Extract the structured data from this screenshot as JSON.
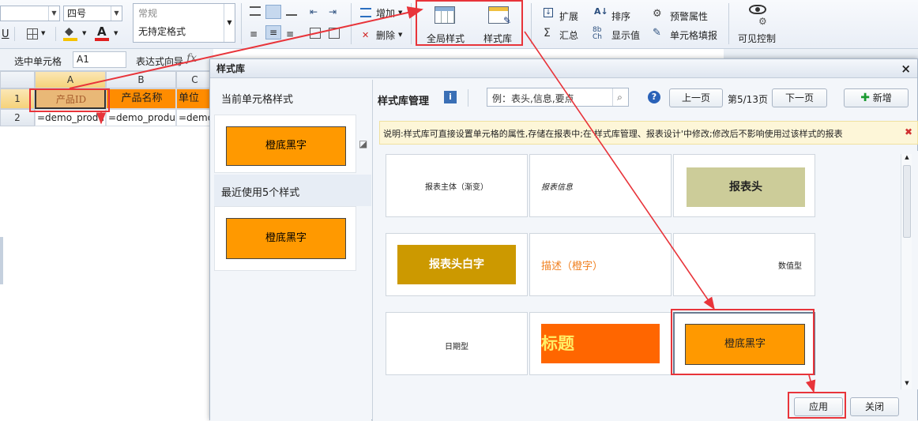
{
  "ribbon": {
    "font_size": "四号",
    "format_label": "常规",
    "format_value": "无持定格式",
    "add_label": "增加",
    "delete_label": "删除",
    "global_style_label": "全局样式",
    "style_lib_label": "样式库",
    "expand_label": "扩展",
    "sort_label": "排序",
    "alert_label": "预警属性",
    "sum_label": "汇总",
    "display_label": "显示值",
    "cell_fill_label": "单元格填报",
    "visible_label": "可见控制",
    "underline": "U",
    "font_color_letter": "A",
    "sigma": "Σ"
  },
  "formula_bar": {
    "selected_label": "选中单元格",
    "cell_ref": "A1",
    "expr_label": "表达式向导",
    "fx": "fx"
  },
  "sheet": {
    "columns": [
      "A",
      "B",
      "C"
    ],
    "rows": [
      "1",
      "2"
    ],
    "row1": [
      "产品ID",
      "产品名称",
      "单位"
    ],
    "row2": [
      "=demo_produ",
      "=demo_produ",
      "=demo_"
    ]
  },
  "dialog": {
    "title": "样式库",
    "close": "×",
    "current_label": "当前单元格样式",
    "current_swatch": "橙底黑字",
    "recent_label": "最近使用5个样式",
    "recent_swatch": "橙底黑字",
    "manage_label": "样式库管理",
    "search_placeholder": "例：表头,信息,要点",
    "prev_label": "上一页",
    "page_info": "第5/13页",
    "next_label": "下一页",
    "add_label": "新增",
    "info_text": "说明:样式库可直接设置单元格的属性,存储在报表中;在'样式库管理、报表设计'中修改;修改后不影响使用过该样式的报表",
    "apply_label": "应用",
    "close_label": "关闭",
    "tiles": [
      "报表主体（渐变）",
      "报表信息",
      "报表头",
      "报表头白字",
      "描述（橙字）",
      "数值型",
      "日期型",
      "标题",
      "橙底黑字"
    ]
  },
  "colors": {
    "orange": "#ff9900",
    "header_orange": "#ff8c00",
    "highlight_red": "#e8343a"
  }
}
